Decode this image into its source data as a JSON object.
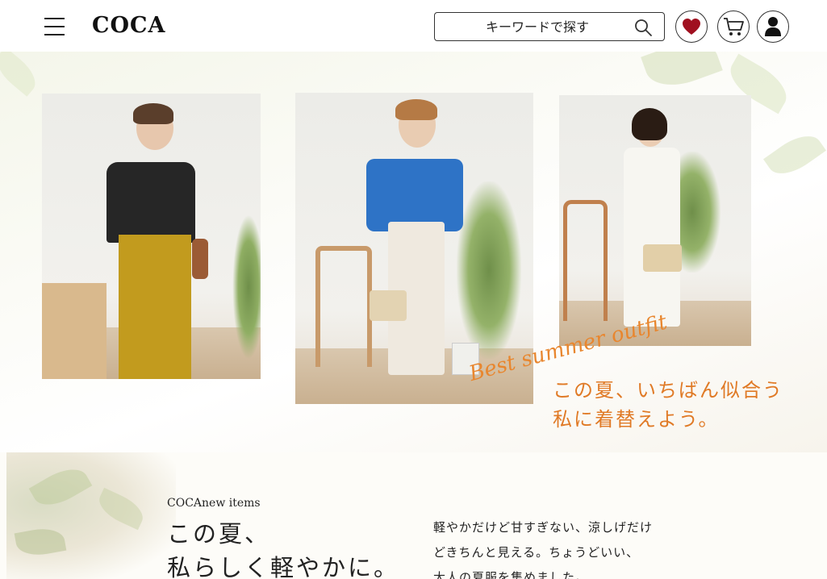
{
  "header": {
    "logo": "COCA",
    "search_placeholder": "キーワードで探す",
    "icons": {
      "menu": "hamburger-menu-icon",
      "search": "search-icon",
      "favorite": "heart-icon",
      "cart": "cart-icon",
      "account": "user-icon"
    },
    "accent_color": "#a01020"
  },
  "hero": {
    "script_text": "Best summer outfit",
    "catch_line1": "この夏、いちばん似合う",
    "catch_line2": "私に着替えよう。",
    "accent_color": "#e07a26"
  },
  "intro": {
    "subtitle": "COCAnew items",
    "headline_line1": "この夏、",
    "headline_line2": "私らしく軽やかに。",
    "body_line1": "軽やかだけど甘すぎない、涼しげだけ",
    "body_line2": "どきちんと見える。ちょうどいい、",
    "body_line3": "大人の夏服を集めました。"
  }
}
